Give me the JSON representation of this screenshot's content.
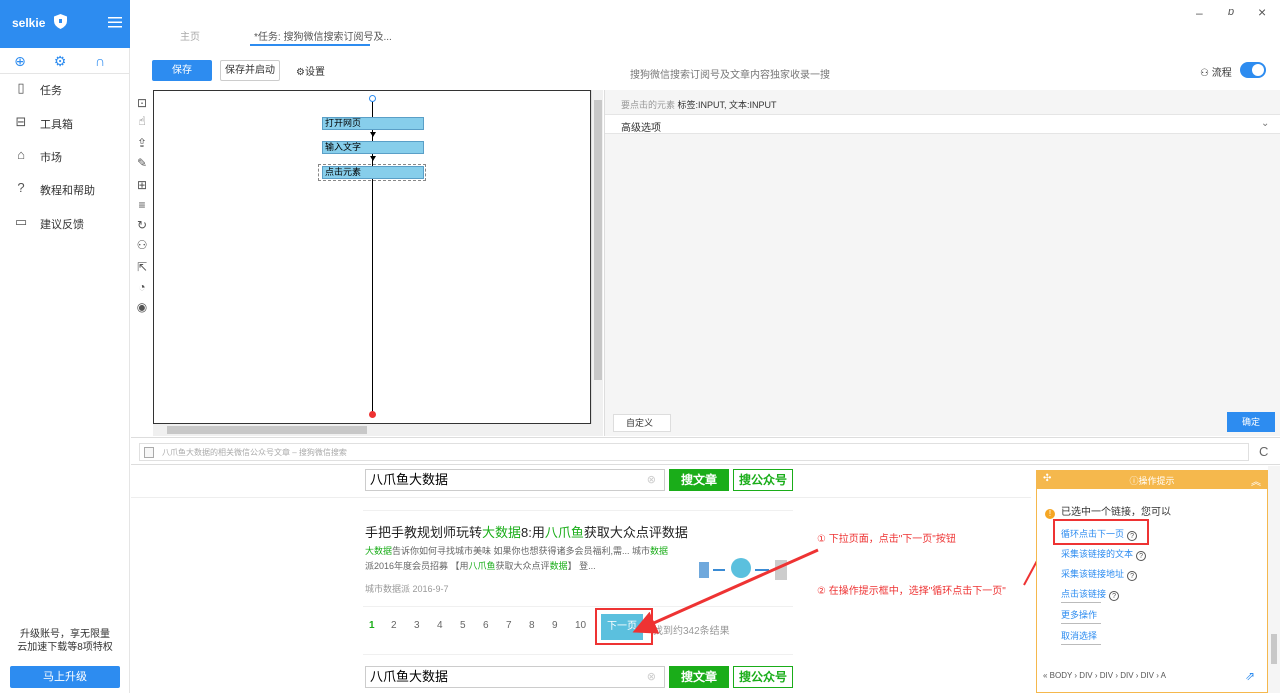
{
  "sidebar": {
    "brand": "selkie",
    "items": [
      {
        "label": "任务",
        "icon": "document-icon"
      },
      {
        "label": "工具箱",
        "icon": "toolbox-icon"
      },
      {
        "label": "市场",
        "icon": "shopping-bag-icon"
      },
      {
        "label": "教程和帮助",
        "icon": "help-icon"
      },
      {
        "label": "建议反馈",
        "icon": "feedback-icon"
      }
    ],
    "upgrade_text_1": "升级账号，享无限量",
    "upgrade_text_2": "云加速下载等8项特权",
    "upgrade_button": "马上升级"
  },
  "tabs": {
    "home": "主页",
    "task": "*任务: 搜狗微信搜索订阅号及..."
  },
  "toolbar": {
    "save": "保存",
    "save_start": "保存并启动",
    "settings": "设置",
    "task_title": "搜狗微信搜索订阅号及文章内容独家收录一搜",
    "flow_label": "流程"
  },
  "flow": {
    "nodes": [
      "打开网页",
      "输入文字",
      "点击元素"
    ]
  },
  "config": {
    "elem_prefix": "要点击的元素",
    "elem_value": "标签:INPUT, 文本:INPUT",
    "advanced": "高级选项",
    "custom": "自定义",
    "confirm": "确定"
  },
  "browser": {
    "url": "八爪鱼大数据的相关微信公众号文章 – 搜狗微信搜索"
  },
  "web": {
    "search_value": "八爪鱼大数据",
    "btn_article": "搜文章",
    "btn_public": "搜公众号",
    "result_title_parts": [
      "手把手教规划师玩转",
      "大数据",
      "8:用",
      "八爪鱼",
      "获取大众点评数据"
    ],
    "result_desc_line1_parts": [
      "大数据",
      "告诉你如何寻找城市美味 如果你也想获得诸多会员福利,需... 城市",
      "数据"
    ],
    "result_desc_line2_parts": [
      "派2016年度会员招募 【用",
      "八爪鱼",
      "获取大众点评",
      "数据",
      "】 登..."
    ],
    "result_meta": "城市数据派    2016-9-7",
    "pages": [
      "1",
      "2",
      "3",
      "4",
      "5",
      "6",
      "7",
      "8",
      "9",
      "10"
    ],
    "next": "下一页",
    "result_count": "找到约342条结果"
  },
  "annotations": {
    "step1": "① 下拉页面，点击\"下一页\"按钮",
    "step2": "② 在操作提示框中，选择\"循环点击下一页\""
  },
  "tips": {
    "title": "操作提示",
    "message": "已选中一个链接，您可以",
    "links": [
      "循环点击下一页",
      "采集该链接的文本",
      "采集该链接地址",
      "点击该链接",
      "更多操作",
      "取消选择"
    ],
    "breadcrumb": "«  BODY  ›  DIV  ›  DIV  ›  DIV  ›  DIV  ›  A"
  },
  "colors": {
    "accent": "#2d8cf0",
    "green": "#1aad19",
    "red": "#e33333",
    "tips_orange": "#f5b84d"
  }
}
